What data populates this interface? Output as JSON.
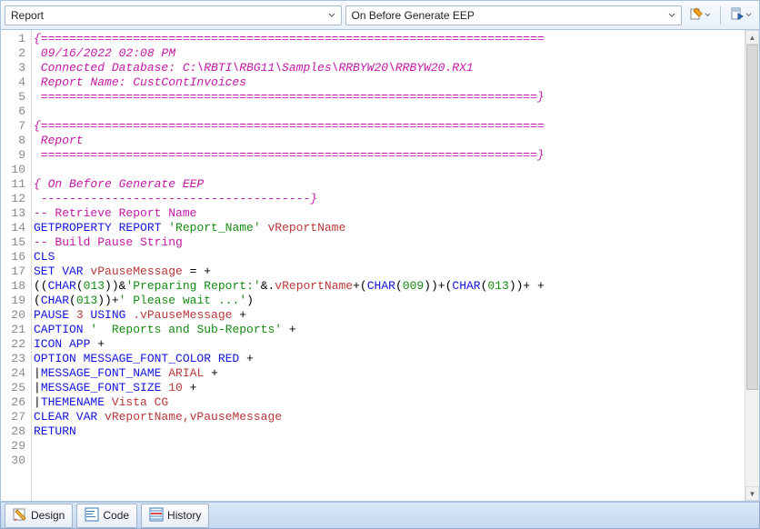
{
  "toolbar": {
    "dropdown_left": "Report",
    "dropdown_right": "On Before Generate EEP"
  },
  "code": {
    "lines": [
      {
        "n": 1,
        "segs": [
          {
            "t": "{=======================================================================",
            "cls": "c-comment-i"
          }
        ]
      },
      {
        "n": 2,
        "segs": [
          {
            "t": " 09/16/2022 02:08 PM",
            "cls": "c-comment-i"
          }
        ]
      },
      {
        "n": 3,
        "segs": [
          {
            "t": " Connected Database: C:\\RBTI\\RBG11\\Samples\\RRBYW20\\RRBYW20.RX1",
            "cls": "c-comment-i"
          }
        ]
      },
      {
        "n": 4,
        "segs": [
          {
            "t": " Report Name: CustContInvoices",
            "cls": "c-comment-i"
          }
        ]
      },
      {
        "n": 5,
        "segs": [
          {
            "t": " ======================================================================}",
            "cls": "c-comment-i"
          }
        ]
      },
      {
        "n": 6,
        "segs": []
      },
      {
        "n": 7,
        "segs": [
          {
            "t": "{=======================================================================",
            "cls": "c-comment-i"
          }
        ]
      },
      {
        "n": 8,
        "segs": [
          {
            "t": " Report",
            "cls": "c-comment-i"
          }
        ]
      },
      {
        "n": 9,
        "segs": [
          {
            "t": " ======================================================================}",
            "cls": "c-comment-i"
          }
        ]
      },
      {
        "n": 10,
        "segs": []
      },
      {
        "n": 11,
        "segs": [
          {
            "t": "{ On Before Generate EEP",
            "cls": "c-comment-i"
          }
        ]
      },
      {
        "n": 12,
        "segs": [
          {
            "t": " --------------------------------------}",
            "cls": "c-comment-i"
          }
        ]
      },
      {
        "n": 13,
        "segs": [
          {
            "t": "-- Retrieve Report Name",
            "cls": "c-comment"
          }
        ]
      },
      {
        "n": 14,
        "segs": [
          {
            "t": "GETPROPERTY REPORT ",
            "cls": "c-kw"
          },
          {
            "t": "'Report_Name'",
            "cls": "c-str"
          },
          {
            "t": " ",
            "cls": ""
          },
          {
            "t": "vReportName",
            "cls": "c-id"
          }
        ]
      },
      {
        "n": 15,
        "segs": [
          {
            "t": "-- Build Pause String",
            "cls": "c-comment"
          }
        ]
      },
      {
        "n": 16,
        "segs": [
          {
            "t": "CLS",
            "cls": "c-kw"
          }
        ]
      },
      {
        "n": 17,
        "segs": [
          {
            "t": "SET VAR ",
            "cls": "c-kw"
          },
          {
            "t": "vPauseMessage",
            "cls": "c-id"
          },
          {
            "t": " = +",
            "cls": "c-pun"
          }
        ]
      },
      {
        "n": 18,
        "segs": [
          {
            "t": "((",
            "cls": "c-pun"
          },
          {
            "t": "CHAR",
            "cls": "c-kw"
          },
          {
            "t": "(",
            "cls": ""
          },
          {
            "t": "013",
            "cls": "c-num"
          },
          {
            "t": "))&",
            "cls": ""
          },
          {
            "t": "'Preparing Report:'",
            "cls": "c-str"
          },
          {
            "t": "&.",
            "cls": ""
          },
          {
            "t": "vReportName",
            "cls": "c-id"
          },
          {
            "t": "+(",
            "cls": ""
          },
          {
            "t": "CHAR",
            "cls": "c-kw"
          },
          {
            "t": "(",
            "cls": ""
          },
          {
            "t": "009",
            "cls": "c-num"
          },
          {
            "t": "))+(",
            "cls": ""
          },
          {
            "t": "CHAR",
            "cls": "c-kw"
          },
          {
            "t": "(",
            "cls": ""
          },
          {
            "t": "013",
            "cls": "c-num"
          },
          {
            "t": "))+ +",
            "cls": ""
          }
        ]
      },
      {
        "n": 19,
        "segs": [
          {
            "t": "(",
            "cls": ""
          },
          {
            "t": "CHAR",
            "cls": "c-kw"
          },
          {
            "t": "(",
            "cls": ""
          },
          {
            "t": "013",
            "cls": "c-num"
          },
          {
            "t": "))+",
            "cls": ""
          },
          {
            "t": "' Please wait ...'",
            "cls": "c-str"
          },
          {
            "t": ")",
            "cls": ""
          }
        ]
      },
      {
        "n": 20,
        "segs": [
          {
            "t": "PAUSE ",
            "cls": "c-kw"
          },
          {
            "t": "3",
            "cls": "c-id"
          },
          {
            "t": " USING ",
            "cls": "c-kw"
          },
          {
            "t": ".vPauseMessage",
            "cls": "c-id"
          },
          {
            "t": " +",
            "cls": "c-pun"
          }
        ]
      },
      {
        "n": 21,
        "segs": [
          {
            "t": "CAPTION ",
            "cls": "c-kw"
          },
          {
            "t": "'  Reports and Sub-Reports'",
            "cls": "c-str"
          },
          {
            "t": " +",
            "cls": "c-pun"
          }
        ]
      },
      {
        "n": 22,
        "segs": [
          {
            "t": "ICON APP",
            "cls": "c-kw"
          },
          {
            "t": " +",
            "cls": "c-pun"
          }
        ]
      },
      {
        "n": 23,
        "segs": [
          {
            "t": "OPTION MESSAGE_FONT_COLOR RED",
            "cls": "c-kw"
          },
          {
            "t": " +",
            "cls": "c-pun"
          }
        ]
      },
      {
        "n": 24,
        "segs": [
          {
            "t": "|",
            "cls": ""
          },
          {
            "t": "MESSAGE_FONT_NAME ",
            "cls": "c-kw"
          },
          {
            "t": "ARIAL",
            "cls": "c-id"
          },
          {
            "t": " +",
            "cls": "c-pun"
          }
        ]
      },
      {
        "n": 25,
        "segs": [
          {
            "t": "|",
            "cls": ""
          },
          {
            "t": "MESSAGE_FONT_SIZE ",
            "cls": "c-kw"
          },
          {
            "t": "10",
            "cls": "c-id"
          },
          {
            "t": " +",
            "cls": "c-pun"
          }
        ]
      },
      {
        "n": 26,
        "segs": [
          {
            "t": "|",
            "cls": ""
          },
          {
            "t": "THEMENAME ",
            "cls": "c-kw"
          },
          {
            "t": "Vista CG",
            "cls": "c-id"
          }
        ]
      },
      {
        "n": 27,
        "segs": [
          {
            "t": "CLEAR VAR ",
            "cls": "c-kw"
          },
          {
            "t": "vReportName,vPauseMessage",
            "cls": "c-id"
          }
        ]
      },
      {
        "n": 28,
        "segs": [
          {
            "t": "RETURN",
            "cls": "c-kw"
          }
        ]
      },
      {
        "n": 29,
        "segs": []
      },
      {
        "n": 30,
        "segs": []
      }
    ]
  },
  "tabs": {
    "design": "Design",
    "code": "Code",
    "history": "History"
  }
}
